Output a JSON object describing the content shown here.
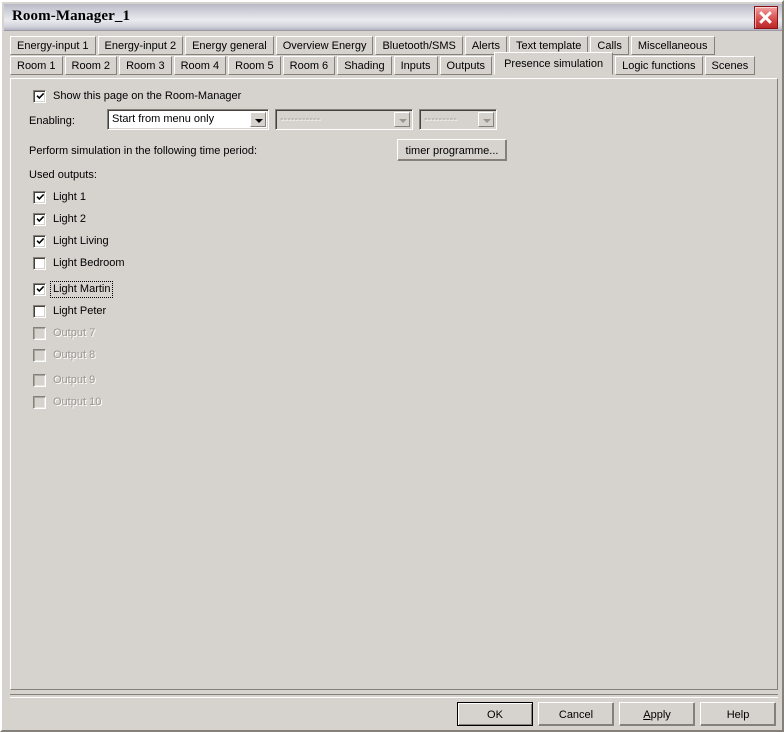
{
  "window": {
    "title": "Room-Manager_1",
    "close_icon": "close-icon"
  },
  "tabs": {
    "row1": [
      {
        "label": "Energy-input 1",
        "active": false
      },
      {
        "label": "Energy-input 2",
        "active": false
      },
      {
        "label": "Energy general",
        "active": false
      },
      {
        "label": "Overview Energy",
        "active": false
      },
      {
        "label": "Bluetooth/SMS",
        "active": false
      },
      {
        "label": "Alerts",
        "active": false
      },
      {
        "label": "Text template",
        "active": false
      },
      {
        "label": "Calls",
        "active": false
      },
      {
        "label": "Miscellaneous",
        "active": false
      }
    ],
    "row2": [
      {
        "label": "Room 1",
        "active": false
      },
      {
        "label": "Room 2",
        "active": false
      },
      {
        "label": "Room 3",
        "active": false
      },
      {
        "label": "Room 4",
        "active": false
      },
      {
        "label": "Room 5",
        "active": false
      },
      {
        "label": "Room 6",
        "active": false
      },
      {
        "label": "Shading",
        "active": false
      },
      {
        "label": "Inputs",
        "active": false
      },
      {
        "label": "Outputs",
        "active": false
      },
      {
        "label": "Presence simulation",
        "active": true
      },
      {
        "label": "Logic functions",
        "active": false
      },
      {
        "label": "Scenes",
        "active": false
      }
    ]
  },
  "page": {
    "show_page_checkbox": {
      "label": "Show this page on the Room-Manager",
      "checked": true
    },
    "enabling": {
      "label": "Enabling:",
      "combo_main": {
        "value": "Start from menu only",
        "enabled": true
      },
      "combo_second": {
        "value": "-----------",
        "enabled": false
      },
      "combo_third": {
        "value": "---------",
        "enabled": false
      }
    },
    "time_period": {
      "label": "Perform simulation in the following time period:",
      "timer_button": "timer programme..."
    },
    "used_outputs": {
      "label": "Used outputs:",
      "items": [
        {
          "label": "Light 1",
          "checked": true,
          "enabled": true,
          "focused": false
        },
        {
          "label": "Light 2",
          "checked": true,
          "enabled": true,
          "focused": false
        },
        {
          "label": "Light Living",
          "checked": true,
          "enabled": true,
          "focused": false
        },
        {
          "label": "Light Bedroom",
          "checked": false,
          "enabled": true,
          "focused": false
        },
        {
          "label": "Light Martin",
          "checked": true,
          "enabled": true,
          "focused": true
        },
        {
          "label": "Light Peter",
          "checked": false,
          "enabled": true,
          "focused": false
        },
        {
          "label": "Output 7",
          "checked": false,
          "enabled": false,
          "focused": false
        },
        {
          "label": "Output 8",
          "checked": false,
          "enabled": false,
          "focused": false
        },
        {
          "label": "Output 9",
          "checked": false,
          "enabled": false,
          "focused": false
        },
        {
          "label": "Output 10",
          "checked": false,
          "enabled": false,
          "focused": false
        }
      ]
    }
  },
  "footer": {
    "buttons": [
      {
        "label": "OK",
        "default": true,
        "accel": ""
      },
      {
        "label": "Cancel",
        "default": false,
        "accel": ""
      },
      {
        "label": "Apply",
        "default": false,
        "accel": "A"
      },
      {
        "label": "Help",
        "default": false,
        "accel": ""
      }
    ]
  },
  "colors": {
    "face": "#d6d3ce",
    "shadow": "#85817a",
    "highlight": "#ffffff",
    "disabled_text": "#9a968f",
    "close_red": "#cf3f3f"
  }
}
